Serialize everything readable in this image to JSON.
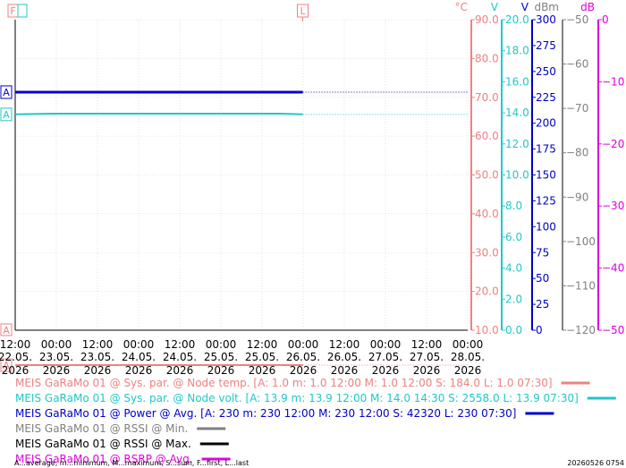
{
  "chart_data": {
    "type": "line",
    "x_ticks": [
      {
        "time": "12:00",
        "date": "22.05.",
        "year": "2026"
      },
      {
        "time": "00:00",
        "date": "23.05.",
        "year": "2026"
      },
      {
        "time": "12:00",
        "date": "23.05.",
        "year": "2026"
      },
      {
        "time": "00:00",
        "date": "24.05.",
        "year": "2026"
      },
      {
        "time": "12:00",
        "date": "24.05.",
        "year": "2026"
      },
      {
        "time": "00:00",
        "date": "25.05.",
        "year": "2026"
      },
      {
        "time": "12:00",
        "date": "25.05.",
        "year": "2026"
      },
      {
        "time": "00:00",
        "date": "26.05.",
        "year": "2026"
      },
      {
        "time": "12:00",
        "date": "26.05.",
        "year": "2026"
      },
      {
        "time": "00:00",
        "date": "27.05.",
        "year": "2026"
      },
      {
        "time": "12:00",
        "date": "27.05.",
        "year": "2026"
      },
      {
        "time": "00:00",
        "date": "28.05.",
        "year": "2026"
      }
    ],
    "xlim": [
      "2026-05-22 12:00",
      "2026-05-28 12:00"
    ],
    "markers": {
      "first": "F",
      "last": "L"
    },
    "axes": [
      {
        "unit": "°C",
        "color": "#f08080",
        "ticks": [
          "10.0",
          "20.0",
          "30.0",
          "40.0",
          "50.0",
          "60.0",
          "70.0",
          "80.0",
          "90.0"
        ],
        "ylim": [
          10,
          90
        ]
      },
      {
        "unit": "V",
        "color": "#20c8c8",
        "ticks": [
          "0.0",
          "2.0",
          "4.0",
          "6.0",
          "8.0",
          "10.0",
          "12.0",
          "14.0",
          "16.0",
          "18.0",
          "20.0"
        ],
        "ylim": [
          0,
          20
        ]
      },
      {
        "unit": "V",
        "color": "#0000c8",
        "ticks": [
          "0",
          "25",
          "50",
          "75",
          "100",
          "125",
          "150",
          "175",
          "200",
          "225",
          "250",
          "275",
          "300"
        ],
        "ylim": [
          0,
          300
        ]
      },
      {
        "unit": "dBm",
        "color": "#808080",
        "ticks": [
          "−120",
          "−110",
          "−100",
          "−90",
          "−80",
          "−70",
          "−60",
          "−50"
        ],
        "ylim": [
          -120,
          -50
        ]
      },
      {
        "unit": "dB",
        "color": "#e000e0",
        "ticks": [
          "−50",
          "−40",
          "−30",
          "−20",
          "−10",
          "0"
        ],
        "ylim": [
          -50,
          0
        ]
      }
    ],
    "series": [
      {
        "name": "MEIS GaRaMo 01 @ Sys. par. @ Node temp. [A: 1.0 m: 1.0 12:00 M: 1.0 12:00 S: 184.0 L: 1.0 07:30]",
        "color": "#f08080",
        "axis": 0,
        "avg": 1.0,
        "x": [
          "2026-05-22 12:00",
          "2026-05-26 07:30"
        ],
        "y": [
          1.0,
          1.0
        ],
        "label": "A"
      },
      {
        "name": "MEIS GaRaMo 01 @ Sys. par. @ Node volt. [A: 13.9 m: 13.9 12:00 M: 14.0 14:30 S: 2558.0 L: 13.9 07:30]",
        "color": "#20c8c8",
        "axis": 1,
        "avg": 13.9,
        "x": [
          "2026-05-22 12:00",
          "2026-05-23 00:00",
          "2026-05-24 09:00",
          "2026-05-26 00:00",
          "2026-05-26 07:30"
        ],
        "y": [
          13.9,
          13.95,
          13.95,
          13.95,
          13.9
        ],
        "label": "A"
      },
      {
        "name": "MEIS GaRaMo 01 @ Power @ Avg. [A: 230 m: 230 12:00 M: 230 12:00 S: 42320 L: 230 07:30]",
        "color": "#0000c8",
        "axis": 2,
        "avg": 230,
        "x": [
          "2026-05-22 12:00",
          "2026-05-26 07:30"
        ],
        "y": [
          230,
          230
        ],
        "label": "A"
      },
      {
        "name": "MEIS GaRaMo 01 @ RSSI @ Min.",
        "color": "#808080",
        "axis": 3
      },
      {
        "name": "MEIS GaRaMo 01 @ RSSI @ Max.",
        "color": "#000000",
        "axis": 3
      },
      {
        "name": "MEIS GaRaMo 01 @ RSRP @ Avg.",
        "color": "#e000e0",
        "axis": 4
      }
    ],
    "footer_left": "A...average, m...minimum, M...maximum, S...sum, F...first, L...last",
    "footer_right": "20260526 0754"
  }
}
